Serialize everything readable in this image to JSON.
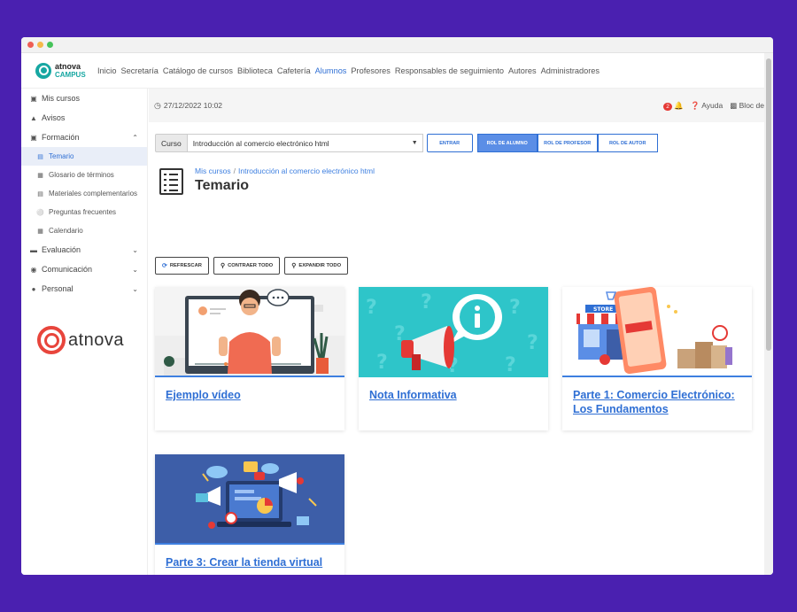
{
  "nav": {
    "logo_line1": "atnova",
    "logo_line2": "CAMPUS",
    "links": [
      "Inicio",
      "Secretaría",
      "Catálogo de cursos",
      "Biblioteca",
      "Cafetería",
      "Alumnos",
      "Profesores",
      "Responsables de seguimiento",
      "Autores",
      "Administradores"
    ],
    "active": "Alumnos"
  },
  "sidebar": {
    "items": [
      {
        "label": "Mis cursos",
        "icon": "book-icon"
      },
      {
        "label": "Avisos",
        "icon": "megaphone-icon"
      },
      {
        "label": "Formación",
        "icon": "book-open-icon"
      }
    ],
    "sub_items": [
      {
        "label": "Temario",
        "icon": "list-icon"
      },
      {
        "label": "Glosario de términos",
        "icon": "glossary-icon"
      },
      {
        "label": "Materiales complementarios",
        "icon": "file-icon"
      },
      {
        "label": "Preguntas frecuentes",
        "icon": "question-icon"
      },
      {
        "label": "Calendario",
        "icon": "calendar-icon"
      }
    ],
    "items_after": [
      {
        "label": "Evaluación",
        "icon": "graduation-icon"
      },
      {
        "label": "Comunicación",
        "icon": "eye-icon"
      },
      {
        "label": "Personal",
        "icon": "users-icon"
      }
    ],
    "brand": "atnova"
  },
  "status": {
    "datetime": "27/12/2022 10:02",
    "notifications": "2",
    "help": "Ayuda",
    "notes": "Bloc de"
  },
  "course": {
    "label": "Curso",
    "selected": "Introducción al comercio electrónico html",
    "enter": "ENTRAR",
    "roles": [
      "ROL DE ALUMNO",
      "ROL DE PROFESOR",
      "ROL DE AUTOR"
    ],
    "active_role": "ROL DE ALUMNO"
  },
  "breadcrumb": {
    "root": "Mis cursos",
    "current": "Introducción al comercio electrónico html"
  },
  "page_title": "Temario",
  "actions": [
    "REFRESCAR",
    "CONTRAER TODO",
    "EXPANDIR TODO"
  ],
  "cards": [
    {
      "title": "Ejemplo vídeo",
      "image": "video-lesson-illustration"
    },
    {
      "title": "Nota Informativa",
      "image": "megaphone-info-illustration"
    },
    {
      "title": "Parte 1: Comercio Electrónico: Los Fundamentos",
      "image": "online-store-illustration"
    },
    {
      "title": "Parte 3: Crear la tienda virtual",
      "image": "digital-marketing-illustration"
    }
  ],
  "colors": {
    "background": "#4a20b0",
    "accent": "#2f6fd4",
    "teal": "#17a7a2",
    "brand_red": "#e8453c"
  }
}
